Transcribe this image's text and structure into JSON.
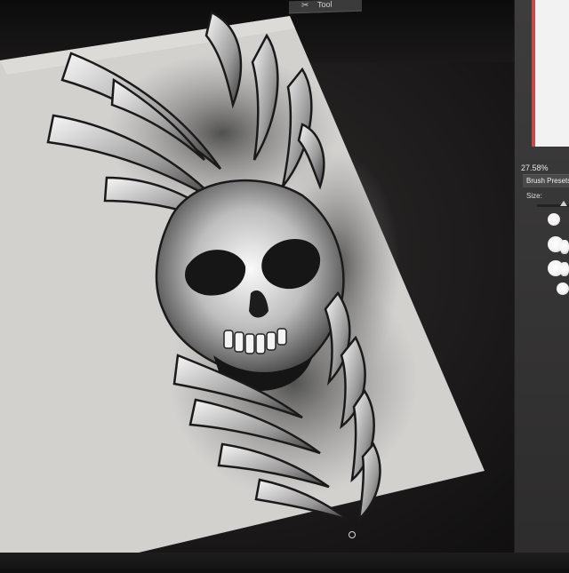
{
  "toolbar": {
    "tab_label": "Tool",
    "tab_icon": "brush-tools-icon"
  },
  "panel": {
    "zoom": "27.58%",
    "brush_presets_label": "Brush Presets",
    "size_label": "Size:",
    "accent_color": "#c94848"
  },
  "canvas": {
    "background": "#d6d4d2",
    "artwork": "skull-illustration"
  }
}
